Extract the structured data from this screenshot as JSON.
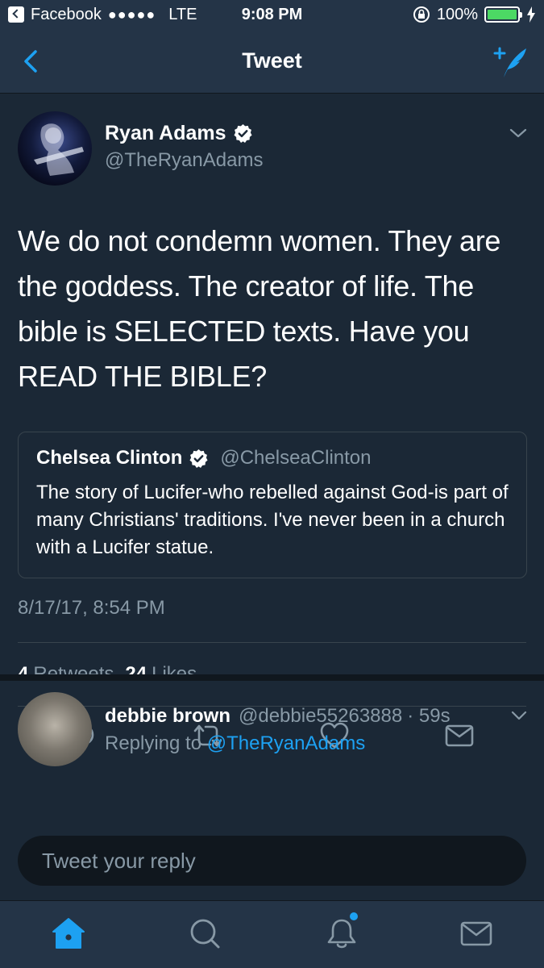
{
  "status_bar": {
    "back_app": "Facebook",
    "signal": "●●●●●",
    "carrier": "LTE",
    "time": "9:08 PM",
    "battery": "100%",
    "battery_level": 1.0
  },
  "nav": {
    "title": "Tweet",
    "back_icon": "chevron-left-icon",
    "compose_icon": "compose-tweet-icon"
  },
  "tweet": {
    "author_name": "Ryan Adams",
    "author_handle": "@TheRyanAdams",
    "verified": true,
    "text": "We do not condemn women. They are the goddess. The creator of life. The bible is SELECTED texts. Have you READ THE BIBLE?",
    "quote": {
      "name": "Chelsea Clinton",
      "handle": "@ChelseaClinton",
      "text": "The story of Lucifer-who rebelled against God-is part of many Christians' traditions. I've never been in a church with a Lucifer statue."
    },
    "timestamp": "8/17/17, 8:54 PM",
    "retweets_count": "4",
    "retweets_label": "Retweets",
    "likes_count": "24",
    "likes_label": "Likes",
    "actions": [
      "reply-icon",
      "retweet-icon",
      "like-icon",
      "direct-message-icon"
    ]
  },
  "reply": {
    "name": "debbie brown",
    "handle": "@debbie55263888",
    "time": "· 59s",
    "replying_to_label": "Replying to",
    "replying_to_handle": "@TheRyanAdams"
  },
  "reply_input": {
    "placeholder": "Tweet your reply"
  },
  "tab_bar": [
    "home-icon",
    "search-icon",
    "notifications-icon",
    "messages-icon"
  ],
  "colors": {
    "background": "#1b2836",
    "bar": "#243447",
    "accent": "#1da1f2",
    "secondary_text": "#8899a6",
    "border": "#38444d"
  }
}
